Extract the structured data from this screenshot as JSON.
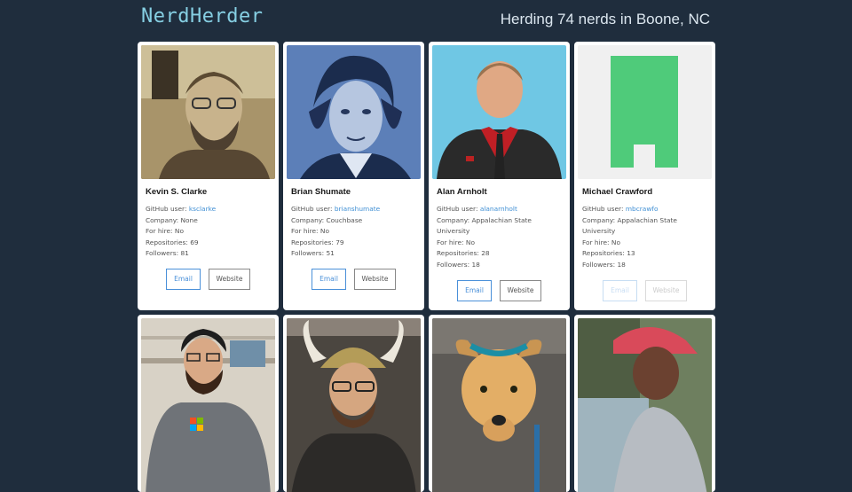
{
  "header": {
    "logo": "NerdHerder",
    "tagline": "Herding 74 nerds in Boone, NC"
  },
  "labels": {
    "github": "GitHub user:",
    "company": "Company:",
    "hire": "For hire:",
    "repos": "Repositories:",
    "followers": "Followers:",
    "email": "Email",
    "website": "Website"
  },
  "nerds": [
    {
      "name": "Kevin S. Clarke",
      "github": "ksclarke",
      "company": "None",
      "hire": "No",
      "repos": "69",
      "followers": "81"
    },
    {
      "name": "Brian Shumate",
      "github": "brianshumate",
      "company": "Couchbase",
      "hire": "No",
      "repos": "79",
      "followers": "51"
    },
    {
      "name": "Alan Arnholt",
      "github": "alanarnholt",
      "company": "Appalachian State University",
      "hire": "No",
      "repos": "28",
      "followers": "18"
    },
    {
      "name": "Michael Crawford",
      "github": "mbcrawfo",
      "company": "Appalachian State University",
      "hire": "No",
      "repos": "13",
      "followers": "18"
    }
  ],
  "colors": {
    "background": "#1f2d3d",
    "logo": "#86cfe3",
    "link": "#3f8fd4",
    "identicon": "#4fcb7a"
  }
}
